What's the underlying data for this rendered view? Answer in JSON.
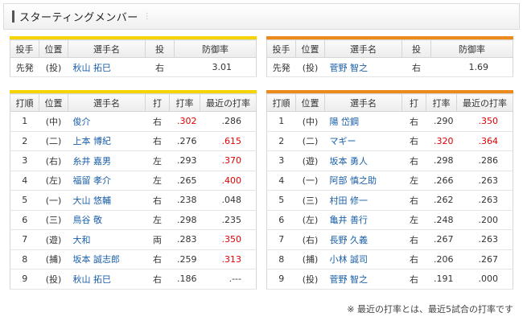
{
  "title": "スターティングメンバー",
  "pitcher_headers": [
    "投手",
    "位置",
    "選手名",
    "投",
    "防御率"
  ],
  "lineup_headers": [
    "打順",
    "位置",
    "選手名",
    "打",
    "打率",
    "最近の打率"
  ],
  "left_pitcher": {
    "role": "先発",
    "pos": "(投)",
    "name": "秋山 拓巳",
    "hand": "右",
    "era": "3.01"
  },
  "right_pitcher": {
    "role": "先発",
    "pos": "(投)",
    "name": "菅野 智之",
    "hand": "右",
    "era": "1.69"
  },
  "left_lineup": [
    {
      "order": "1",
      "pos": "(中)",
      "name": "俊介",
      "hand": "右",
      "avg": ".302",
      "recent": ".286",
      "avg_hot": true,
      "recent_hot": false
    },
    {
      "order": "2",
      "pos": "(二)",
      "name": "上本 博紀",
      "hand": "右",
      "avg": ".276",
      "recent": ".615",
      "avg_hot": false,
      "recent_hot": true
    },
    {
      "order": "3",
      "pos": "(右)",
      "name": "糸井 嘉男",
      "hand": "左",
      "avg": ".293",
      "recent": ".370",
      "avg_hot": false,
      "recent_hot": true
    },
    {
      "order": "4",
      "pos": "(左)",
      "name": "福留 孝介",
      "hand": "左",
      "avg": ".265",
      "recent": ".400",
      "avg_hot": false,
      "recent_hot": true
    },
    {
      "order": "5",
      "pos": "(一)",
      "name": "大山 悠輔",
      "hand": "右",
      "avg": ".238",
      "recent": ".048",
      "avg_hot": false,
      "recent_hot": false
    },
    {
      "order": "6",
      "pos": "(三)",
      "name": "鳥谷 敬",
      "hand": "左",
      "avg": ".298",
      "recent": ".235",
      "avg_hot": false,
      "recent_hot": false
    },
    {
      "order": "7",
      "pos": "(遊)",
      "name": "大和",
      "hand": "両",
      "avg": ".283",
      "recent": ".350",
      "avg_hot": false,
      "recent_hot": true
    },
    {
      "order": "8",
      "pos": "(捕)",
      "name": "坂本 誠志郎",
      "hand": "右",
      "avg": ".259",
      "recent": ".313",
      "avg_hot": false,
      "recent_hot": true
    },
    {
      "order": "9",
      "pos": "(投)",
      "name": "秋山 拓巳",
      "hand": "右",
      "avg": ".186",
      "recent": ".---",
      "avg_hot": false,
      "recent_hot": false
    }
  ],
  "right_lineup": [
    {
      "order": "1",
      "pos": "(中)",
      "name": "陽 岱鋼",
      "hand": "右",
      "avg": ".290",
      "recent": ".350",
      "avg_hot": false,
      "recent_hot": true
    },
    {
      "order": "2",
      "pos": "(二)",
      "name": "マギー",
      "hand": "右",
      "avg": ".320",
      "recent": ".364",
      "avg_hot": true,
      "recent_hot": true
    },
    {
      "order": "3",
      "pos": "(遊)",
      "name": "坂本 勇人",
      "hand": "右",
      "avg": ".298",
      "recent": ".286",
      "avg_hot": false,
      "recent_hot": false
    },
    {
      "order": "4",
      "pos": "(一)",
      "name": "阿部 慎之助",
      "hand": "左",
      "avg": ".266",
      "recent": ".263",
      "avg_hot": false,
      "recent_hot": false
    },
    {
      "order": "5",
      "pos": "(三)",
      "name": "村田 修一",
      "hand": "右",
      "avg": ".262",
      "recent": ".263",
      "avg_hot": false,
      "recent_hot": false
    },
    {
      "order": "6",
      "pos": "(左)",
      "name": "亀井 善行",
      "hand": "左",
      "avg": ".248",
      "recent": ".200",
      "avg_hot": false,
      "recent_hot": false
    },
    {
      "order": "7",
      "pos": "(右)",
      "name": "長野 久義",
      "hand": "右",
      "avg": ".267",
      "recent": ".263",
      "avg_hot": false,
      "recent_hot": false
    },
    {
      "order": "8",
      "pos": "(捕)",
      "name": "小林 誠司",
      "hand": "右",
      "avg": ".206",
      "recent": ".267",
      "avg_hot": false,
      "recent_hot": false
    },
    {
      "order": "9",
      "pos": "(投)",
      "name": "菅野 智之",
      "hand": "右",
      "avg": ".191",
      "recent": ".000",
      "avg_hot": false,
      "recent_hot": false
    }
  ],
  "footnote": "※ 最近の打率とは、最近5試合の打率です",
  "colors": {
    "left_accent": "#f5d400",
    "right_accent": "#ec8a1c",
    "hot": "#e00000",
    "link": "#1a5fa8"
  }
}
